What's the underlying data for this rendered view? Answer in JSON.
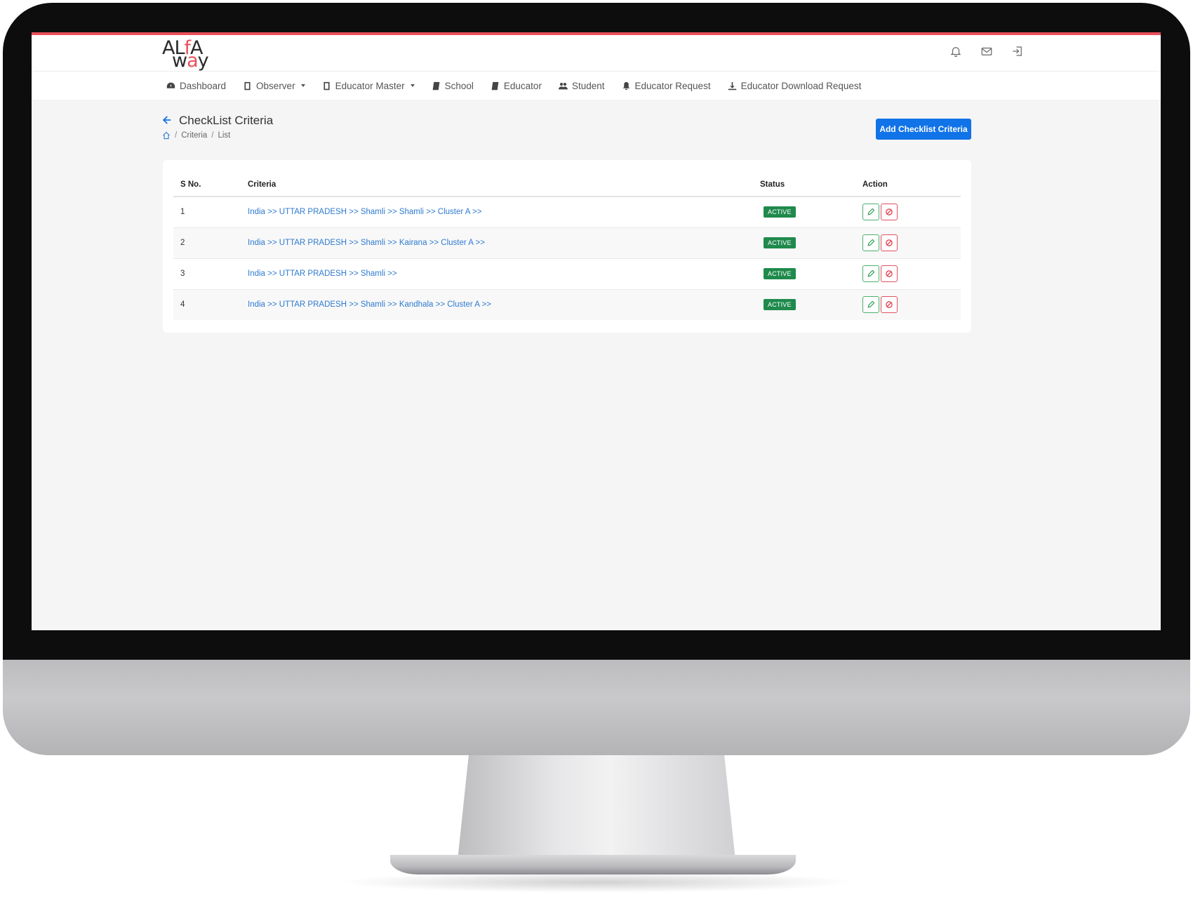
{
  "brand": {
    "logo_top_a": "AL",
    "logo_top_f": "f",
    "logo_top_b": "A",
    "logo_bot_a": "w",
    "logo_bot_b": "a",
    "logo_bot_c": "y",
    "accent_color": "#e8505b"
  },
  "header": {
    "icons": [
      "bell-icon",
      "mail-icon",
      "logout-icon"
    ]
  },
  "nav": {
    "items": [
      {
        "label": "Dashboard",
        "icon": "dashboard-icon",
        "dropdown": false
      },
      {
        "label": "Observer",
        "icon": "book-icon",
        "dropdown": true
      },
      {
        "label": "Educator Master",
        "icon": "book-icon",
        "dropdown": true
      },
      {
        "label": "School",
        "icon": "book-open-icon",
        "dropdown": false
      },
      {
        "label": "Educator",
        "icon": "book-open-icon",
        "dropdown": false
      },
      {
        "label": "Student",
        "icon": "users-icon",
        "dropdown": false
      },
      {
        "label": "Educator Request",
        "icon": "bell-icon",
        "dropdown": false
      },
      {
        "label": "Educator Download Request",
        "icon": "download-icon",
        "dropdown": false
      }
    ]
  },
  "page": {
    "title": "CheckList Criteria",
    "breadcrumb": [
      "Criteria",
      "List"
    ],
    "breadcrumb_sep": "/",
    "add_button": "Add Checklist Criteria",
    "button_color": "#1173e8"
  },
  "table": {
    "headers": {
      "sno": "S No.",
      "criteria": "Criteria",
      "status": "Status",
      "action": "Action"
    },
    "rows": [
      {
        "sno": "1",
        "criteria": "India >> UTTAR PRADESH >> Shamli >> Shamli >> Cluster A >>",
        "status": "ACTIVE"
      },
      {
        "sno": "2",
        "criteria": "India >> UTTAR PRADESH >> Shamli >> Kairana >> Cluster A >>",
        "status": "ACTIVE"
      },
      {
        "sno": "3",
        "criteria": "India >> UTTAR PRADESH >> Shamli >>",
        "status": "ACTIVE"
      },
      {
        "sno": "4",
        "criteria": "India >> UTTAR PRADESH >> Shamli >> Kandhala >> Cluster A >>",
        "status": "ACTIVE"
      }
    ],
    "status_color": "#1f8a4c",
    "link_color": "#2e7bd1"
  }
}
